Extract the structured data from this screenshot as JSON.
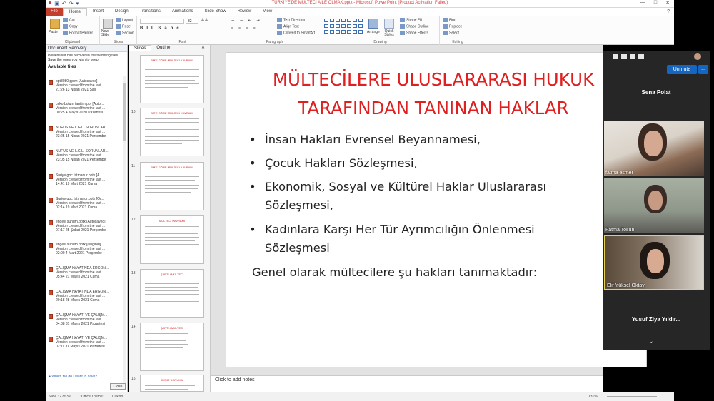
{
  "window": {
    "title": "TÜRKİYE'DE MÜLTECİ AİLE OLMAK.pptx  -  Microsoft PowerPoint (Product Activation Failed)",
    "help": "?"
  },
  "ribbon": {
    "file_tab": "File",
    "tabs": [
      "Home",
      "Insert",
      "Design",
      "Transitions",
      "Animations",
      "Slide Show",
      "Review",
      "View"
    ],
    "clipboard": {
      "paste": "Paste",
      "cut": "Cut",
      "copy": "Copy",
      "format_painter": "Format Painter",
      "label": "Clipboard"
    },
    "slides": {
      "new_slide": "New Slide",
      "layout": "Layout",
      "reset": "Reset",
      "section": "Section",
      "label": "Slides"
    },
    "font": {
      "font_size": "32",
      "label": "Font"
    },
    "paragraph": {
      "text_direction": "Text Direction",
      "align_text": "Align Text",
      "convert_smartart": "Convert to SmartArt",
      "label": "Paragraph"
    },
    "drawing": {
      "arrange": "Arrange",
      "quick_styles": "Quick Styles",
      "shape_fill": "Shape Fill",
      "shape_outline": "Shape Outline",
      "shape_effects": "Shape Effects",
      "label": "Drawing"
    },
    "editing": {
      "find": "Find",
      "replace": "Replace",
      "select": "Select",
      "label": "Editing"
    }
  },
  "recovery": {
    "header": "Document Recovery",
    "message": "PowerPoint has recovered the following files. Save the ones you wish to keep.",
    "available": "Available files",
    "files": [
      {
        "name": "ppt8080.pptm  [Autosaved]",
        "info": "Version created from the last ...",
        "time": "21:26 13 Nisan 2021 Salı"
      },
      {
        "name": "ceko bolum tanitim.ppt  [Auto...",
        "info": "Version created from the last ...",
        "time": "00:25 4 Mayıs 2020 Pazartesi"
      },
      {
        "name": "NÜFUS VE İLGİLİ SORUNLAR....",
        "info": "Version created from the last ...",
        "time": "23:25 15 Nisan 2021 Perşembe"
      },
      {
        "name": "NÜFUS VE İLGİLİ SORUNLAR....",
        "info": "Version created from the last ...",
        "time": "23:05 15 Nisan 2021 Perşembe"
      },
      {
        "name": "Suriye goc fatmanur.pptx  [A...",
        "info": "Version created from the last ...",
        "time": "14:41 19 Mart 2021 Cuma"
      },
      {
        "name": "Suriye goc fatmanur.pptx  [Or...",
        "info": "Version created from the last ...",
        "time": "02:14 19 Mart 2021 Cuma"
      },
      {
        "name": "engelli sunum.pptx  [Autosaved]",
        "info": "Version created from the last ...",
        "time": "07:17 25 Şubat 2021 Perşembe"
      },
      {
        "name": "engelli sunum.pptx  [Original]",
        "info": "Version created from the last ...",
        "time": "02:00 4 Mart 2021 Perşembe"
      },
      {
        "name": "ÇALIŞMA HAYATINDA ERGON...",
        "info": "Version created from the last ...",
        "time": "05:44 21 Mayıs 2021 Cuma"
      },
      {
        "name": "ÇALIŞMA HAYATINDA ERGON...",
        "info": "Version created from the last ...",
        "time": "20:18 28 Mayıs 2021 Cuma"
      },
      {
        "name": "ÇALIŞMA HAYATI VE ÇALIŞM...",
        "info": "Version created from the last ...",
        "time": "04:38 31 Mayıs 2021 Pazartesi"
      },
      {
        "name": "ÇALIŞMA HAYATI VE ÇALIŞM...",
        "info": "Version created from the last ...",
        "time": "02:11 31 Mayıs 2021 Pazartesi"
      }
    ],
    "which_file": "Which file do I want to save?",
    "close": "Close"
  },
  "slides_pane": {
    "tabs": [
      "Slides",
      "Outline"
    ],
    "thumbnails": [
      {
        "num": "",
        "title": "BM'E GÖRE MÜLTECİ KAVRAMI"
      },
      {
        "num": "10",
        "title": "BM'E GÖRE MÜLTECİ KAVRAMI"
      },
      {
        "num": "11",
        "title": "BM'E GÖRE MÜLTECİ KAVRAMI"
      },
      {
        "num": "12",
        "title": "MÜLTECİ KAVRAMI"
      },
      {
        "num": "13",
        "title": "ŞARTLI MÜLTECİ"
      },
      {
        "num": "14",
        "title": "ŞARTLI MÜLTECİ"
      },
      {
        "num": "15",
        "title": "İKİNCİ KORUMA"
      }
    ]
  },
  "slide": {
    "title_line1": "MÜLTECİLERE ULUSLARARASI HUKUK",
    "title_line2": "TARAFINDAN TANINAN HAKLAR",
    "bullets": [
      {
        "text": "İnsan Hakları Evrensel Beyannamesi,"
      },
      {
        "text": "Çocuk Hakları Sözleşmesi,"
      },
      {
        "text": " Ekonomik, Sosyal ve Kültürel Haklar Uluslararası",
        "text2": "Sözleşmesi,"
      },
      {
        "text": "Kadınlara Karşı Her Tür Ayrımcılığın Önlenmesi",
        "text2": "Sözleşmesi"
      }
    ],
    "closing": "Genel olarak mültecilere şu hakları tanımaktadır:",
    "bullet_char": "•",
    "notes_placeholder": "Click to add notes"
  },
  "statusbar": {
    "slide": "Slide 32 of 39",
    "theme": "\"Office Theme\"",
    "language": "Turkish",
    "zoom": "131%"
  },
  "meeting": {
    "unmute": "Unmute",
    "more": "...",
    "host": "Sena Polat",
    "participants": [
      {
        "name": "fatma esmer"
      },
      {
        "name": "Fatma Tosun"
      },
      {
        "name": "Elif Yüksel Oktay"
      }
    ],
    "bottom_participant": "Yusuf  Ziya  Yıldır...",
    "chevron": "⌄"
  }
}
